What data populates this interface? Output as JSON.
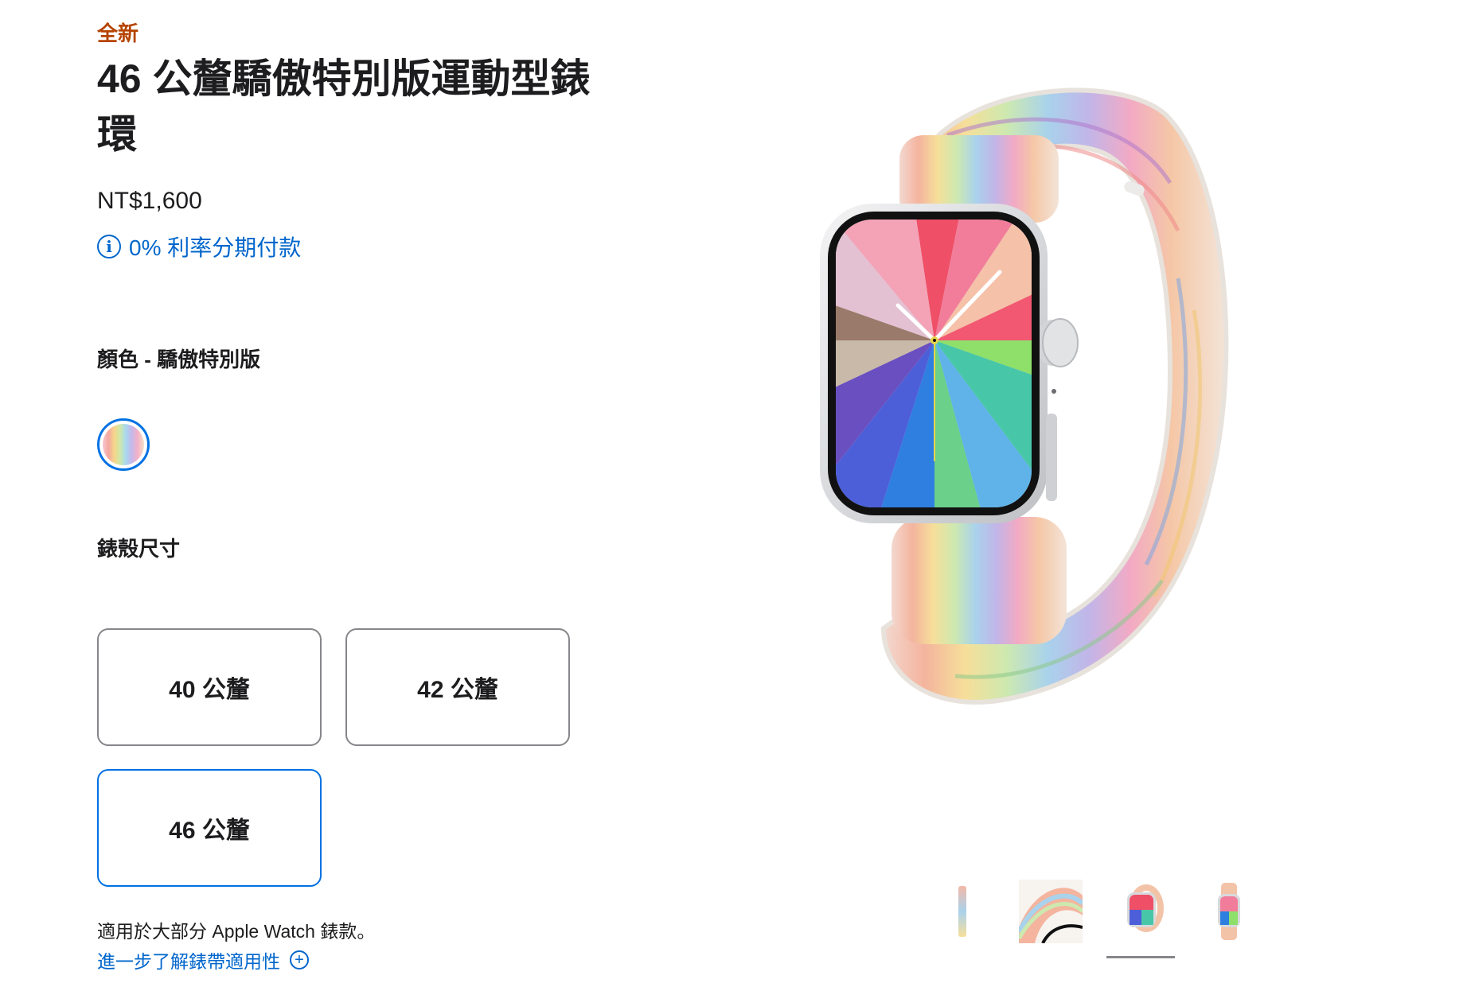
{
  "product": {
    "new_tag": "全新",
    "title": "46 公釐驕傲特別版運動型錶環",
    "price": "NT$1,600",
    "installment": "0% 利率分期付款"
  },
  "color": {
    "label": "顏色 - 驕傲特別版",
    "selected": "驕傲特別版"
  },
  "case_size": {
    "label": "錶殼尺寸",
    "options": [
      {
        "label": "40 公釐"
      },
      {
        "label": "42 公釐"
      },
      {
        "label": "46 公釐"
      }
    ],
    "selected": "46 公釐"
  },
  "compat": {
    "text": "適用於大部分 Apple Watch 錶款。",
    "link": "進一步了解錶帶適用性"
  },
  "gallery": {
    "selected_thumb": 2,
    "thumbs": [
      "band-side-view",
      "band-closeup",
      "watch-front",
      "watch-back"
    ]
  },
  "colors": {
    "accent": "#0071e3",
    "link": "#0066cc",
    "new_tag": "#b64400",
    "text": "#1d1d1f",
    "border": "#86868b"
  }
}
